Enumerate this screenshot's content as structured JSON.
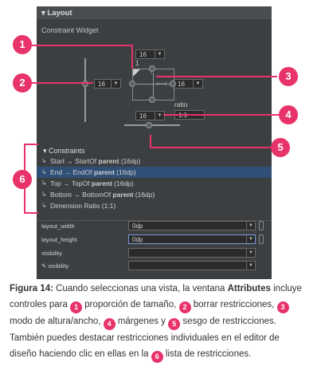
{
  "panel": {
    "header": "▾ Layout",
    "subtitle": "Constraint Widget",
    "margins": {
      "top": "16",
      "left": "16",
      "right": "16",
      "bottom": "16"
    },
    "ratio_label": "ratio",
    "ratio_value": "1:1",
    "corner_label": "1",
    "constraints_title": "▾ Constraints",
    "constraints": [
      {
        "pre": "Start → StartOf ",
        "bold": "parent",
        "post": " (16dp)"
      },
      {
        "pre": "End → EndOf ",
        "bold": "parent",
        "post": " (16dp)"
      },
      {
        "pre": "Top → TopOf ",
        "bold": "parent",
        "post": " (16dp)"
      },
      {
        "pre": "Bottom → BottomOf ",
        "bold": "parent",
        "post": " (16dp)"
      },
      {
        "pre": "Dimension Ratio ",
        "bold": "",
        "post": "(1:1)"
      }
    ],
    "attributes": [
      {
        "label": "layout_width",
        "value": "0dp"
      },
      {
        "label": "layout_height",
        "value": "0dp"
      },
      {
        "label": "visibility",
        "value": ""
      },
      {
        "label": "✎ visibility",
        "value": ""
      }
    ]
  },
  "callouts": [
    "1",
    "2",
    "3",
    "4",
    "5",
    "6"
  ],
  "caption": {
    "fig": "Figura 14:",
    "p1": " Cuando seleccionas una vista, la ventana ",
    "attrs": "Attributes",
    "p2": " incluye controles para ",
    "t1": " proporción de tamaño, ",
    "t2": " borrar restricciones, ",
    "t3": " modo de altura/ancho, ",
    "t4": " márgenes y ",
    "t5": " sesgo de restricciones. También puedes destacar restricciones individuales en el editor de diseño haciendo clic en ellas en la ",
    "t6": " lista de restricciones."
  },
  "colors": {
    "accent": "#e8326a",
    "panel_bg": "#3c3f41",
    "selected_row": "#2f4f77"
  }
}
